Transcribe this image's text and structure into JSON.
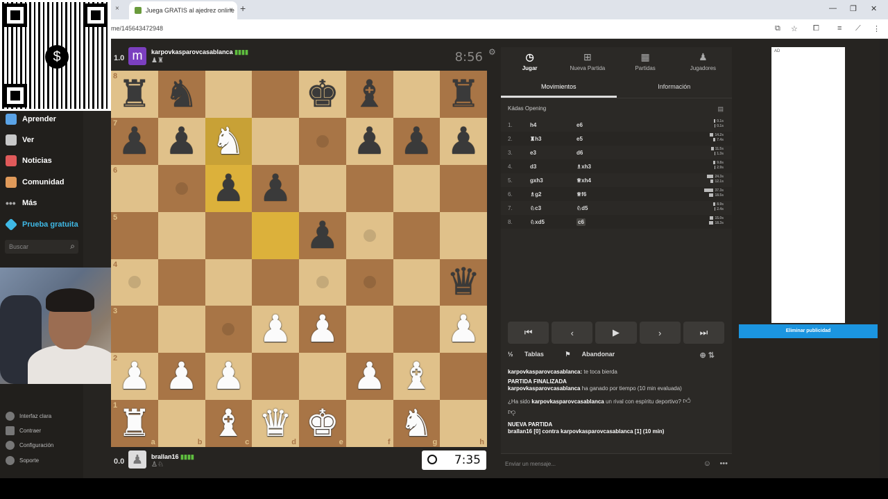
{
  "browser": {
    "tab_title": "Juega GRATIS al ajedrez online",
    "url": "me/145643472948",
    "new_tab": "+",
    "close": "×",
    "win_min": "—",
    "win_max": "❐",
    "win_close": "✕"
  },
  "qr_center": "$",
  "sidebar": {
    "items": [
      {
        "label": "Aprender",
        "icon": "graduation-cap-icon",
        "color": "#5aa3e6"
      },
      {
        "label": "Ver",
        "icon": "binoculars-icon",
        "color": "#c8c8c8"
      },
      {
        "label": "Noticias",
        "icon": "newspaper-icon",
        "color": "#e05a5a"
      },
      {
        "label": "Comunidad",
        "icon": "people-icon",
        "color": "#e09a5a"
      },
      {
        "label": "Más",
        "icon": "more-dots-icon",
        "color": "#aaaaaa"
      },
      {
        "label": "Prueba gratuita",
        "icon": "diamond-icon",
        "color": "#3fb9e6"
      }
    ],
    "search_placeholder": "Buscar",
    "bottom": [
      {
        "label": "Interfaz clara",
        "icon": "theme-icon"
      },
      {
        "label": "Contraer",
        "icon": "collapse-icon"
      },
      {
        "label": "Configuración",
        "icon": "gear-icon"
      },
      {
        "label": "Soporte",
        "icon": "help-icon"
      }
    ]
  },
  "top_player": {
    "score": "1.0",
    "avatar_letter": "m",
    "avatar_color": "#7b3fbf",
    "name": "karpovkasparovcasablanca",
    "rating_bars": "▮▮▮▮",
    "captured": "♟♜",
    "clock": "8:56"
  },
  "bottom_player": {
    "score": "0.0",
    "name": "brallan16",
    "rating_bars": "▮▮▮▮",
    "captured": "♙♘",
    "clock": "7:35"
  },
  "board": {
    "ranks": [
      "8",
      "7",
      "6",
      "5",
      "4",
      "3",
      "2",
      "1"
    ],
    "files": [
      "a",
      "b",
      "c",
      "d",
      "e",
      "f",
      "g",
      "h"
    ],
    "rows": [
      [
        "r",
        "n",
        "",
        "",
        "k",
        "b",
        "",
        "r"
      ],
      [
        "p",
        "p",
        "N",
        "",
        "",
        "p",
        "p",
        "p"
      ],
      [
        "",
        "",
        "p",
        "p",
        "",
        "",
        "",
        ""
      ],
      [
        "",
        "",
        "",
        "",
        "p",
        "",
        "",
        ""
      ],
      [
        "",
        "",
        "",
        "",
        "",
        "",
        "",
        "q"
      ],
      [
        "",
        "",
        "",
        "P",
        "P",
        "",
        "",
        "P"
      ],
      [
        "P",
        "P",
        "P",
        "",
        "",
        "P",
        "B",
        ""
      ],
      [
        "R",
        "",
        "B",
        "Q",
        "K",
        "",
        "N",
        ""
      ]
    ],
    "highlights": [
      "c7",
      "d5",
      "c6"
    ],
    "dots": [
      "b6",
      "f5",
      "e4",
      "a4",
      "f4",
      "c3",
      "e7"
    ]
  },
  "panel": {
    "tabs": [
      {
        "label": "Jugar",
        "icon": "stopwatch-icon",
        "glyph": "◷"
      },
      {
        "label": "Nueva Partida",
        "icon": "plus-square-icon",
        "glyph": "⊞"
      },
      {
        "label": "Partidas",
        "icon": "grid-icon",
        "glyph": "▦"
      },
      {
        "label": "Jugadores",
        "icon": "players-icon",
        "glyph": "♟"
      }
    ],
    "subtabs": [
      "Movimientos",
      "Información"
    ],
    "opening": "Kádas Opening",
    "moves": [
      {
        "num": "1.",
        "white": "h4",
        "black": "e6",
        "t1": "0.1s",
        "t2": "0.1s",
        "b1": 2,
        "b2": 1
      },
      {
        "num": "2.",
        "white": "♜h3",
        "black": "e5",
        "t1": "14.2s",
        "t2": "7.4s",
        "b1": 5,
        "b2": 3
      },
      {
        "num": "3.",
        "white": "e3",
        "black": "d6",
        "t1": "11.5s",
        "t2": "1.3s",
        "b1": 4,
        "b2": 1
      },
      {
        "num": "4.",
        "white": "d3",
        "black": "♗xh3",
        "t1": "9.8s",
        "t2": "2.9s",
        "b1": 3,
        "b2": 1
      },
      {
        "num": "5.",
        "white": "gxh3",
        "black": "♕xh4",
        "t1": "24.3s",
        "t2": "12.1s",
        "b1": 9,
        "b2": 4
      },
      {
        "num": "6.",
        "white": "♗g2",
        "black": "♕f6",
        "t1": "37.3s",
        "t2": "18.5s",
        "b1": 13,
        "b2": 6
      },
      {
        "num": "7.",
        "white": "♘c3",
        "black": "♘d5",
        "t1": "8.9s",
        "t2": "2.4s",
        "b1": 3,
        "b2": 1
      },
      {
        "num": "8.",
        "white": "♘xd5",
        "black": "c6",
        "t1": "15.0s",
        "t2": "18.3s",
        "b1": 5,
        "b2": 6
      }
    ],
    "controls": [
      "⏮",
      "‹",
      "▶",
      "›",
      "⏭"
    ],
    "draw": "Tablas",
    "resign": "Abandonar",
    "chat": {
      "line1_user": "karpovkasparovcasablanca:",
      "line1_text": "te toca bierda",
      "finished": "PARTIDA FINALIZADA",
      "won_user": "karpovkasparovcasablanca",
      "won_text": "ha ganado por tiempo (10 min evaluada)",
      "sport_pre": "¿Ha sido",
      "sport_user": "karpovkasparovcasablanca",
      "sport_post": "un rival con espíritu deportivo?",
      "new_game": "NUEVA PARTIDA",
      "ng_p1": "brallan16 [0] contra",
      "ng_user": "karpovkasparovcasablanca",
      "ng_post": "[1] (10 min)"
    },
    "message_placeholder": "Enviar un mensaje..."
  },
  "ad": {
    "label": "AD",
    "remove": "Eliminar publicidad"
  }
}
